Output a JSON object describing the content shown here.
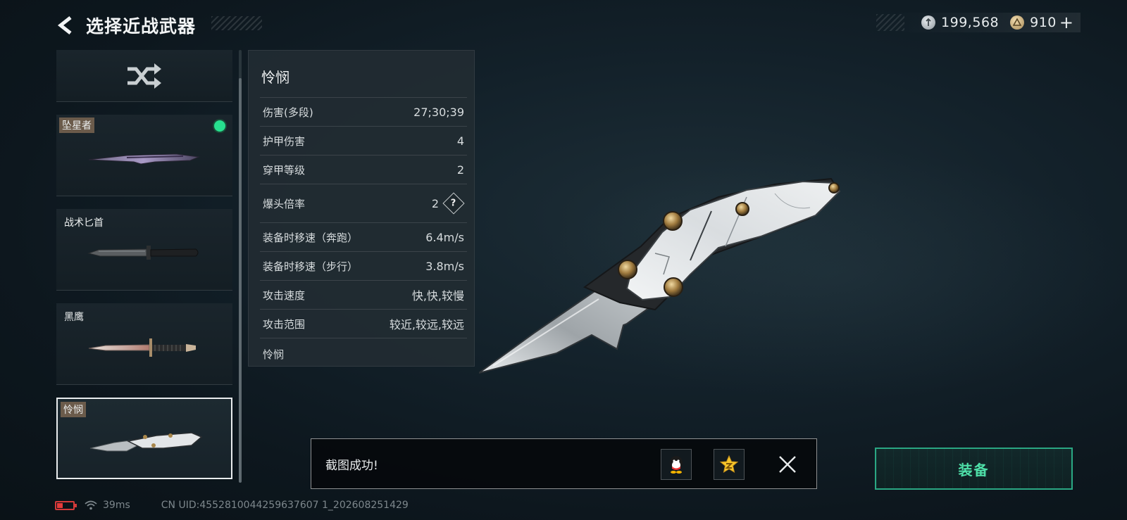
{
  "header": {
    "title": "选择近战武器",
    "back_icon": "back-arrow-icon"
  },
  "currency": {
    "silver": "199,568",
    "gold": "910",
    "plus": "+"
  },
  "weapons": [
    {
      "kind": "random",
      "icon": "shuffle-icon"
    },
    {
      "name": "坠星者",
      "equipped": true
    },
    {
      "name": "战术匕首",
      "equipped": false
    },
    {
      "name": "黑鹰",
      "equipped": false
    },
    {
      "name": "怜悯",
      "equipped": false,
      "selected": true
    }
  ],
  "stats": {
    "name": "怜悯",
    "rows": [
      {
        "label": "伤害(多段)",
        "value": "27;30;39"
      },
      {
        "label": "护甲伤害",
        "value": "4"
      },
      {
        "label": "穿甲等级",
        "value": "2"
      },
      {
        "label": "爆头倍率",
        "value": "2",
        "help": "?"
      },
      {
        "label": "装备时移速（奔跑）",
        "value": "6.4m/s"
      },
      {
        "label": "装备时移速（步行）",
        "value": "3.8m/s"
      },
      {
        "label": "攻击速度",
        "value": "快,快,较慢"
      },
      {
        "label": "攻击范围",
        "value": "较近,较远,较远"
      }
    ],
    "footer": "怜悯"
  },
  "toast": {
    "text": "截图成功!",
    "share_qq_icon": "qq-icon",
    "share_qzone_icon": "qzone-icon",
    "close_icon": "close-icon"
  },
  "equip_button": {
    "label": "装备",
    "color": "#4fe0a9"
  },
  "status": {
    "ping": "39ms",
    "uid": "CN UID:4552810044259637607 1_202608251429"
  },
  "colors": {
    "equipped_dot": "#27e08f",
    "battery_low": "#d23a3a"
  }
}
